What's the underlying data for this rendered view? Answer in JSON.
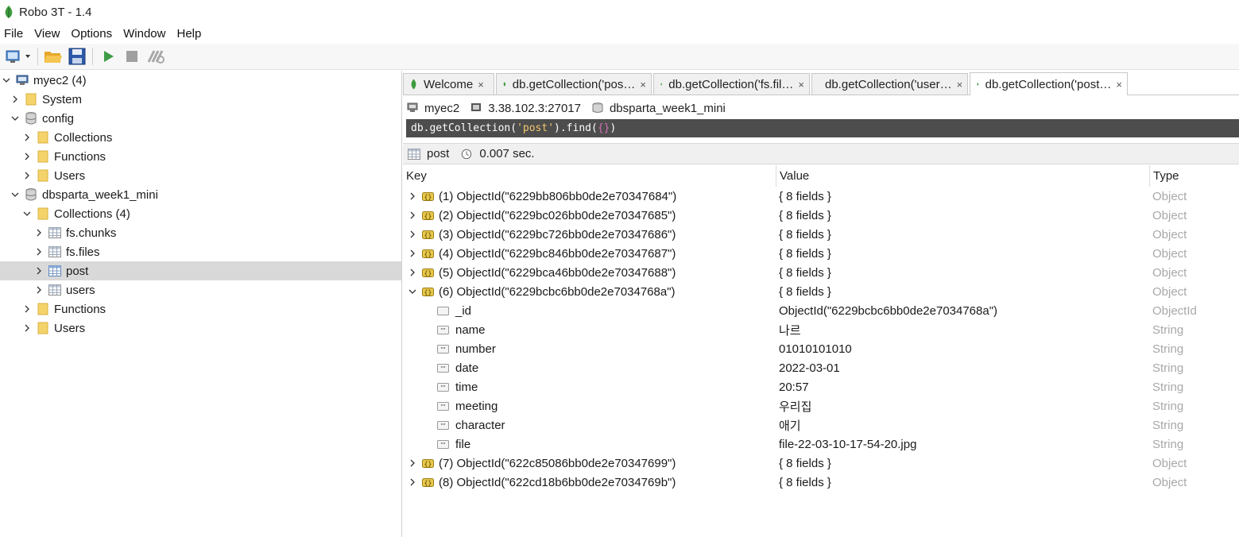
{
  "window": {
    "title": "Robo 3T - 1.4"
  },
  "menu": [
    "File",
    "View",
    "Options",
    "Window",
    "Help"
  ],
  "toolbar": {
    "icons": [
      "connect-icon",
      "open-folder-icon",
      "save-icon",
      "run-icon",
      "stop-icon",
      "format-icon"
    ]
  },
  "explorer": {
    "items": [
      {
        "label": "myec2 (4)",
        "icon": "server-icon",
        "expanded": true
      },
      {
        "label": "System",
        "icon": "folder-icon",
        "expanded": false
      },
      {
        "label": "config",
        "icon": "database-icon",
        "expanded": true
      },
      {
        "label": "Collections",
        "icon": "folder-icon",
        "expanded": false
      },
      {
        "label": "Functions",
        "icon": "folder-icon",
        "expanded": false
      },
      {
        "label": "Users",
        "icon": "folder-icon",
        "expanded": false
      },
      {
        "label": "dbsparta_week1_mini",
        "icon": "database-icon",
        "expanded": true
      },
      {
        "label": "Collections (4)",
        "icon": "folder-icon",
        "expanded": true
      },
      {
        "label": "fs.chunks",
        "icon": "collection-icon",
        "expanded": false
      },
      {
        "label": "fs.files",
        "icon": "collection-icon",
        "expanded": false
      },
      {
        "label": "post",
        "icon": "collection-icon",
        "expanded": false,
        "selected": true
      },
      {
        "label": "users",
        "icon": "collection-icon",
        "expanded": false
      },
      {
        "label": "Functions",
        "icon": "folder-icon",
        "expanded": false
      },
      {
        "label": "Users",
        "icon": "folder-icon",
        "expanded": false
      }
    ]
  },
  "tabs": [
    {
      "label": "Welcome",
      "close": "×",
      "active": false
    },
    {
      "label": "db.getCollection('pos…",
      "close": "×",
      "active": false
    },
    {
      "label": "db.getCollection('fs.fil…",
      "close": "×",
      "active": false
    },
    {
      "label": "db.getCollection('user…",
      "close": "×",
      "active": false
    },
    {
      "label": "db.getCollection('post…",
      "close": "×",
      "active": true
    }
  ],
  "connection": {
    "server": "myec2",
    "address": "3.38.102.3:27017",
    "database": "dbsparta_week1_mini"
  },
  "query": {
    "prefix": "db.getCollection(",
    "string": "'post'",
    "middle": ").find(",
    "braces": "{}",
    "suffix": ")"
  },
  "result": {
    "collection": "post",
    "time": "0.007 sec."
  },
  "grid": {
    "columns": [
      "Key",
      "Value",
      "Type"
    ],
    "rows": [
      {
        "key": "(1) ObjectId(\"6229bb806bb0de2e70347684\")",
        "value": "{ 8 fields }",
        "type": "Object",
        "kind": "object",
        "expanded": false
      },
      {
        "key": "(2) ObjectId(\"6229bc026bb0de2e70347685\")",
        "value": "{ 8 fields }",
        "type": "Object",
        "kind": "object",
        "expanded": false
      },
      {
        "key": "(3) ObjectId(\"6229bc726bb0de2e70347686\")",
        "value": "{ 8 fields }",
        "type": "Object",
        "kind": "object",
        "expanded": false
      },
      {
        "key": "(4) ObjectId(\"6229bc846bb0de2e70347687\")",
        "value": "{ 8 fields }",
        "type": "Object",
        "kind": "object",
        "expanded": false
      },
      {
        "key": "(5) ObjectId(\"6229bca46bb0de2e70347688\")",
        "value": "{ 8 fields }",
        "type": "Object",
        "kind": "object",
        "expanded": false
      },
      {
        "key": "(6) ObjectId(\"6229bcbc6bb0de2e7034768a\")",
        "value": "{ 8 fields }",
        "type": "Object",
        "kind": "object",
        "expanded": true
      },
      {
        "key": "_id",
        "value": "ObjectId(\"6229bcbc6bb0de2e7034768a\")",
        "type": "ObjectId",
        "kind": "id"
      },
      {
        "key": "name",
        "value": "나르",
        "type": "String",
        "kind": "string"
      },
      {
        "key": "number",
        "value": "01010101010",
        "type": "String",
        "kind": "string"
      },
      {
        "key": "date",
        "value": "2022-03-01",
        "type": "String",
        "kind": "string"
      },
      {
        "key": "time",
        "value": "20:57",
        "type": "String",
        "kind": "string"
      },
      {
        "key": "meeting",
        "value": "우리집",
        "type": "String",
        "kind": "string"
      },
      {
        "key": "character",
        "value": "애기",
        "type": "String",
        "kind": "string"
      },
      {
        "key": "file",
        "value": "file-22-03-10-17-54-20.jpg",
        "type": "String",
        "kind": "string"
      },
      {
        "key": "(7) ObjectId(\"622c85086bb0de2e70347699\")",
        "value": "{ 8 fields }",
        "type": "Object",
        "kind": "object",
        "expanded": false
      },
      {
        "key": "(8) ObjectId(\"622cd18b6bb0de2e7034769b\")",
        "value": "{ 8 fields }",
        "type": "Object",
        "kind": "object",
        "expanded": false
      }
    ]
  },
  "colors": {
    "leaf": "#3e9b3e",
    "folder": "#f5d36b",
    "query_bg": "#4d4d4d",
    "query_string": "#f2c66d",
    "query_brace": "#d46fb8",
    "type_text": "#a8a8a8",
    "selection": "#d9d9d9"
  }
}
